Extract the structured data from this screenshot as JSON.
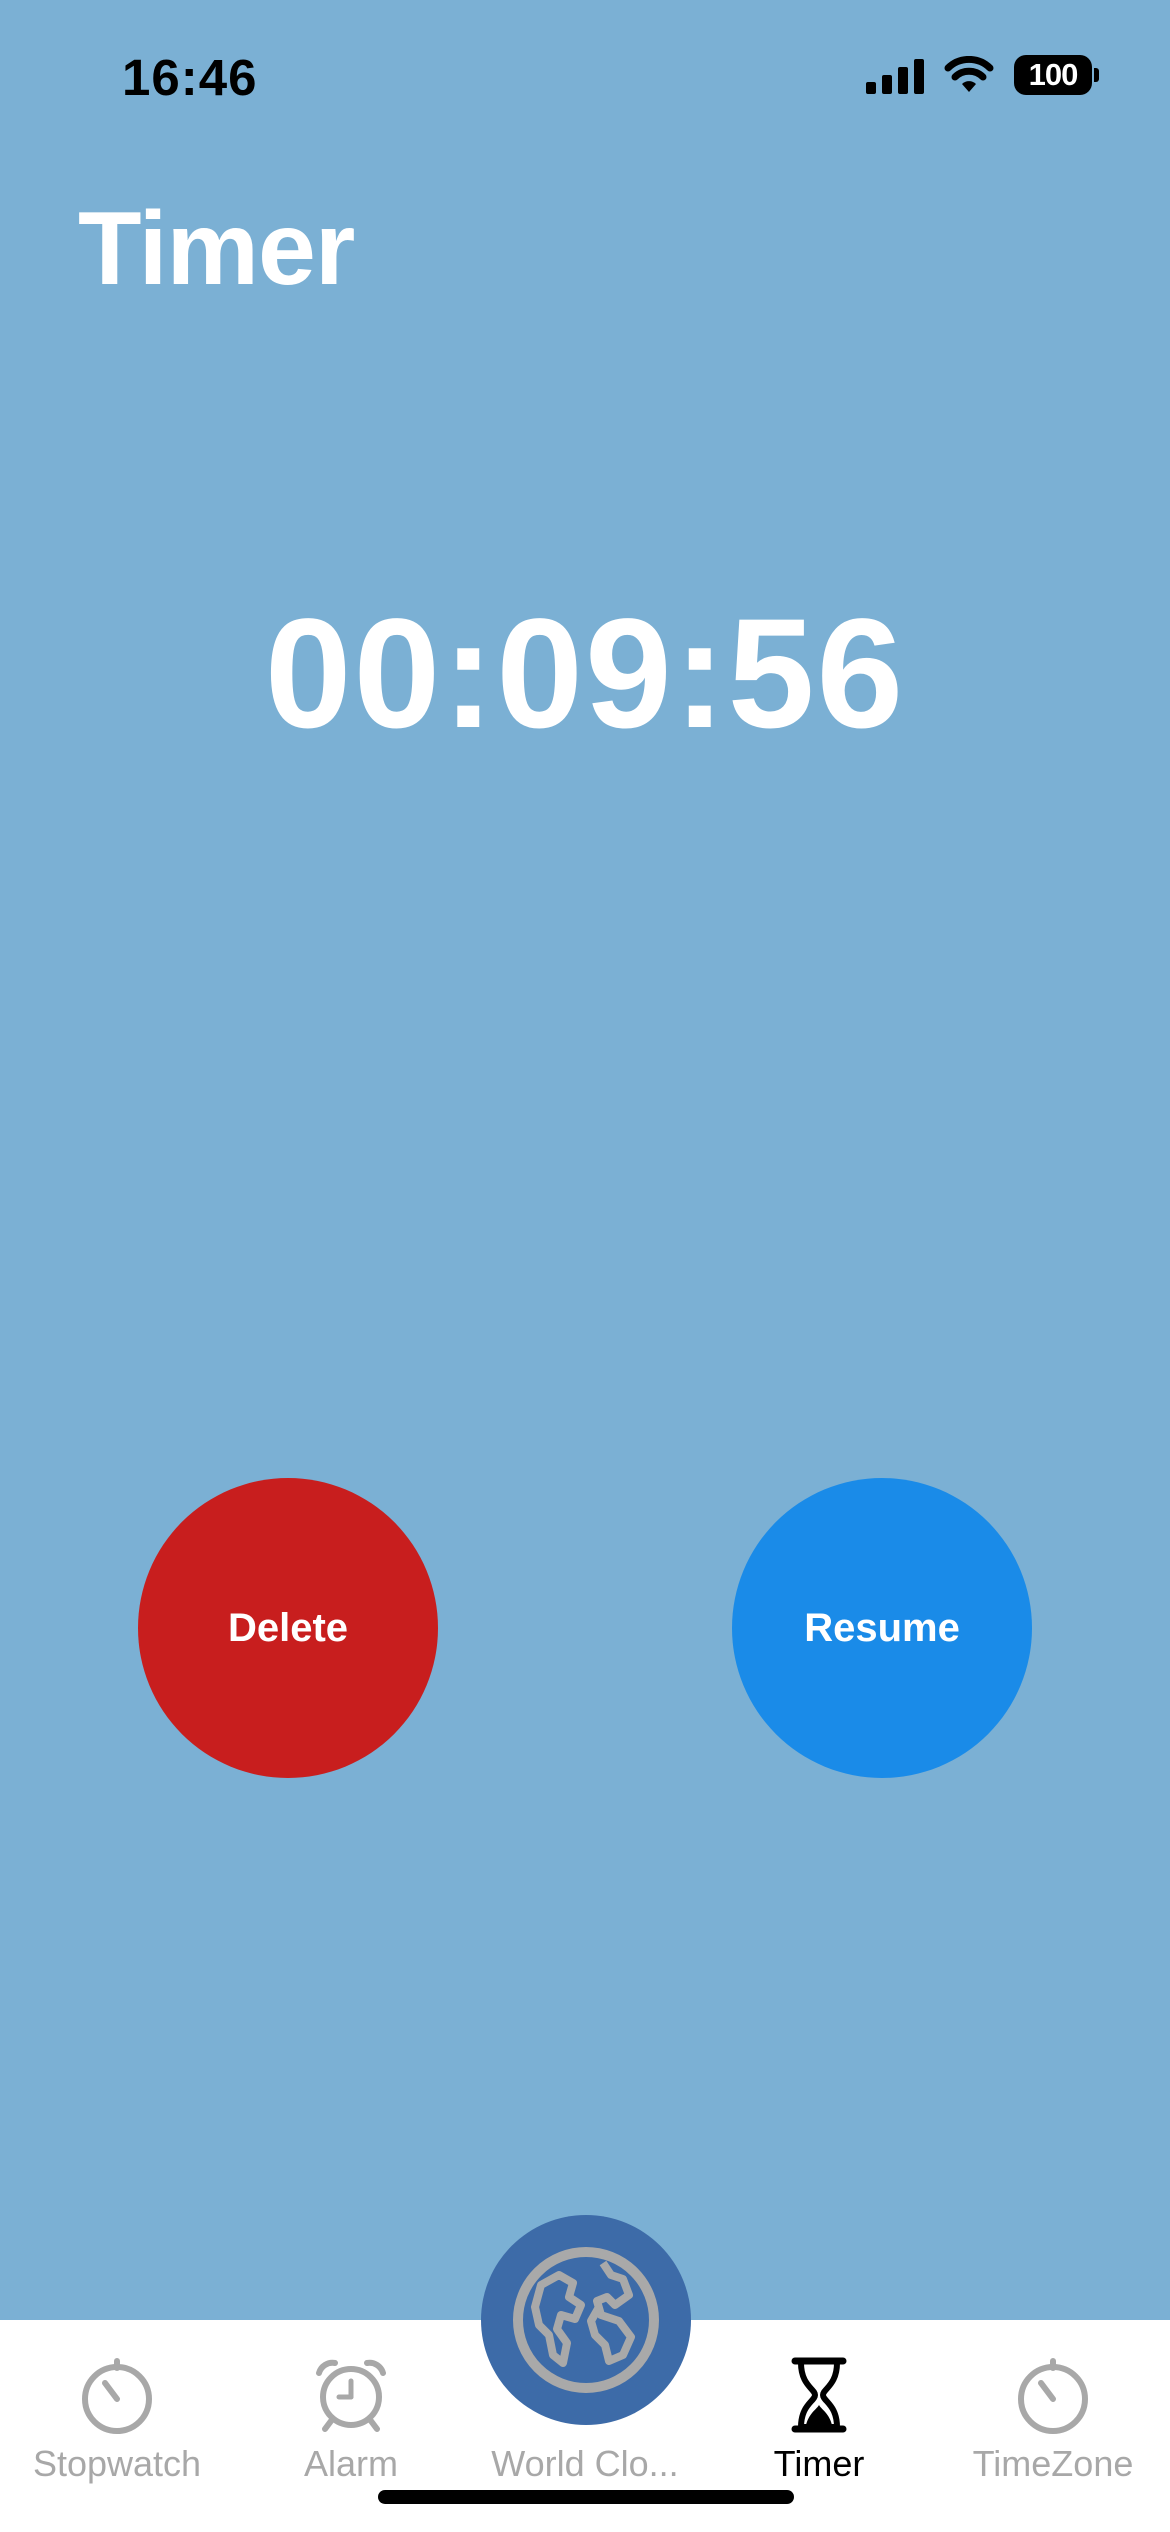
{
  "status_bar": {
    "time": "16:46",
    "battery": "100",
    "icons": [
      "cellular-signal-icon",
      "wifi-icon",
      "battery-icon"
    ]
  },
  "page": {
    "title": "Timer"
  },
  "timer": {
    "remaining": "00:09:56"
  },
  "actions": {
    "delete_label": "Delete",
    "resume_label": "Resume"
  },
  "tab_bar": {
    "tabs": [
      {
        "label": "Stopwatch",
        "icon": "stopwatch-icon",
        "active": false
      },
      {
        "label": "Alarm",
        "icon": "alarm-clock-icon",
        "active": false
      },
      {
        "label": "World Clo...",
        "icon": "globe-icon",
        "active": false
      },
      {
        "label": "Timer",
        "icon": "hourglass-icon",
        "active": true
      },
      {
        "label": "TimeZone",
        "icon": "stopwatch-icon",
        "active": false
      }
    ]
  },
  "colors": {
    "background": "#7bb0d4",
    "delete": "#c81e1e",
    "resume": "#1a8be8",
    "center_tab": "#3d6ba8",
    "inactive_tab": "#a8a8a8"
  }
}
